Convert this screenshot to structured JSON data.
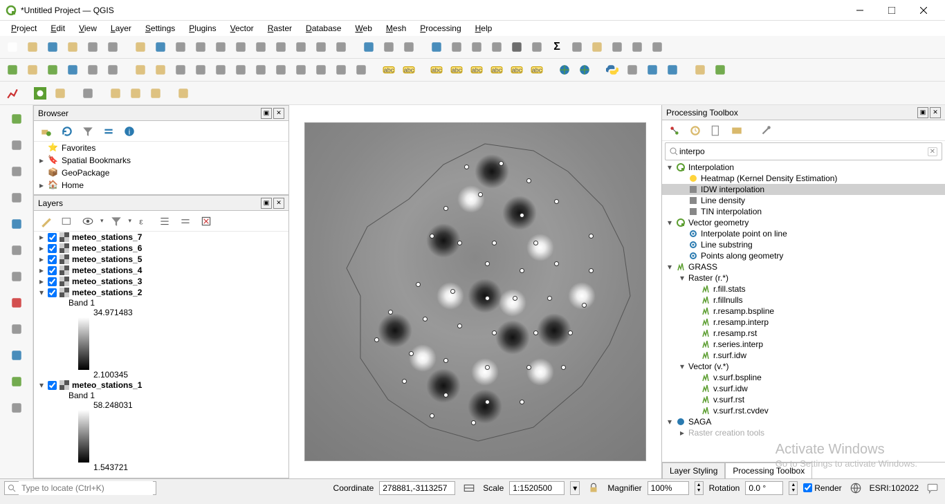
{
  "title": "*Untitled Project — QGIS",
  "menu": [
    "Project",
    "Edit",
    "View",
    "Layer",
    "Settings",
    "Plugins",
    "Vector",
    "Raster",
    "Database",
    "Web",
    "Mesh",
    "Processing",
    "Help"
  ],
  "browser": {
    "title": "Browser",
    "items": [
      {
        "icon": "star",
        "label": "Favorites"
      },
      {
        "icon": "bookmark",
        "label": "Spatial Bookmarks",
        "exp": "▸"
      },
      {
        "icon": "geopkg",
        "label": "GeoPackage"
      },
      {
        "icon": "home",
        "label": "Home",
        "exp": "▸"
      }
    ]
  },
  "layers": {
    "title": "Layers",
    "items": [
      {
        "name": "meteo_stations_7",
        "checked": true,
        "exp": "▸"
      },
      {
        "name": "meteo_stations_6",
        "checked": true,
        "exp": "▸"
      },
      {
        "name": "meteo_stations_5",
        "checked": true,
        "exp": "▸"
      },
      {
        "name": "meteo_stations_4",
        "checked": true,
        "exp": "▸"
      },
      {
        "name": "meteo_stations_3",
        "checked": true,
        "exp": "▸"
      },
      {
        "name": "meteo_stations_2",
        "checked": true,
        "exp": "▾",
        "band": "Band 1",
        "max": "34.971483",
        "min": "2.100345"
      },
      {
        "name": "meteo_stations_1",
        "checked": true,
        "exp": "▾",
        "band": "Band 1",
        "max": "58.248031",
        "min": "1.543721"
      }
    ]
  },
  "toolbox": {
    "title": "Processing Toolbox",
    "search": "interpo",
    "tree": [
      {
        "lvl": 0,
        "exp": "▾",
        "icon": "q",
        "label": "Interpolation",
        "bold": false
      },
      {
        "lvl": 1,
        "icon": "heat",
        "label": "Heatmap (Kernel Density Estimation)"
      },
      {
        "lvl": 1,
        "icon": "idw",
        "label": "IDW interpolation",
        "sel": true
      },
      {
        "lvl": 1,
        "icon": "dens",
        "label": "Line density"
      },
      {
        "lvl": 1,
        "icon": "tin",
        "label": "TIN interpolation"
      },
      {
        "lvl": 0,
        "exp": "▾",
        "icon": "q",
        "label": "Vector geometry"
      },
      {
        "lvl": 1,
        "icon": "gear",
        "label": "Interpolate point on line"
      },
      {
        "lvl": 1,
        "icon": "gear",
        "label": "Line substring"
      },
      {
        "lvl": 1,
        "icon": "gear",
        "label": "Points along geometry"
      },
      {
        "lvl": 0,
        "exp": "▾",
        "icon": "grass",
        "label": "GRASS"
      },
      {
        "lvl": 1,
        "exp": "▾",
        "label": "Raster (r.*)"
      },
      {
        "lvl": 2,
        "icon": "grass",
        "label": "r.fill.stats"
      },
      {
        "lvl": 2,
        "icon": "grass",
        "label": "r.fillnulls"
      },
      {
        "lvl": 2,
        "icon": "grass",
        "label": "r.resamp.bspline"
      },
      {
        "lvl": 2,
        "icon": "grass",
        "label": "r.resamp.interp"
      },
      {
        "lvl": 2,
        "icon": "grass",
        "label": "r.resamp.rst"
      },
      {
        "lvl": 2,
        "icon": "grass",
        "label": "r.series.interp"
      },
      {
        "lvl": 2,
        "icon": "grass",
        "label": "r.surf.idw"
      },
      {
        "lvl": 1,
        "exp": "▾",
        "label": "Vector (v.*)"
      },
      {
        "lvl": 2,
        "icon": "grass",
        "label": "v.surf.bspline"
      },
      {
        "lvl": 2,
        "icon": "grass",
        "label": "v.surf.idw"
      },
      {
        "lvl": 2,
        "icon": "grass",
        "label": "v.surf.rst"
      },
      {
        "lvl": 2,
        "icon": "grass",
        "label": "v.surf.rst.cvdev"
      },
      {
        "lvl": 0,
        "exp": "▾",
        "icon": "saga",
        "label": "SAGA"
      },
      {
        "lvl": 1,
        "exp": "▸",
        "label": "Raster creation tools",
        "dim": true
      }
    ],
    "tabs": [
      "Layer Styling",
      "Processing Toolbox"
    ],
    "active_tab": 1
  },
  "status": {
    "locate_placeholder": "Type to locate (Ctrl+K)",
    "coord_label": "Coordinate",
    "coord": "278881,-3113257",
    "scale_label": "Scale",
    "scale": "1:1520500",
    "mag_label": "Magnifier",
    "mag": "100%",
    "rot_label": "Rotation",
    "rot": "0.0 °",
    "render": "Render",
    "crs": "ESRI:102022"
  },
  "watermark": {
    "l1": "Activate Windows",
    "l2": "Go to Settings to activate Windows."
  },
  "colors": {
    "sel": "#d0d0d0",
    "accent": "#5c9e31"
  }
}
